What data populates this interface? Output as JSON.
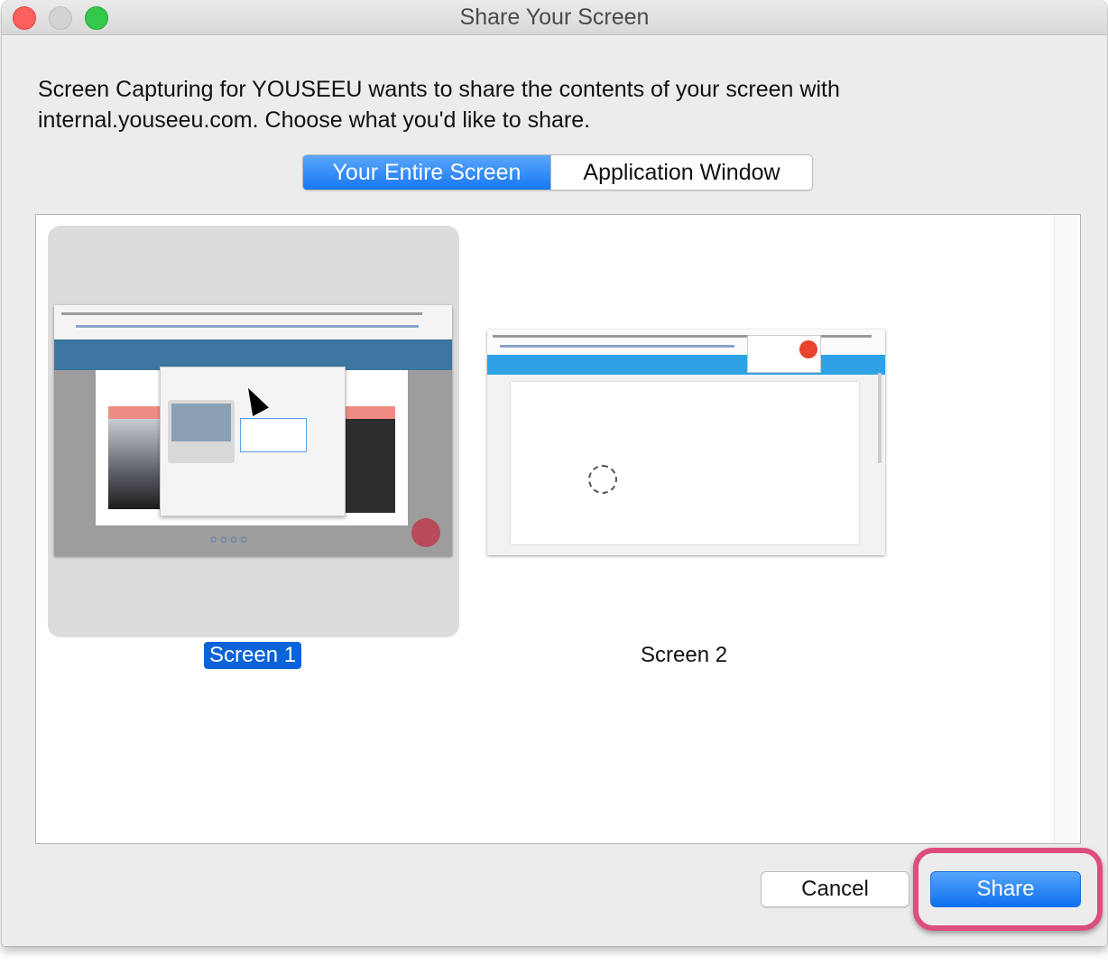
{
  "window": {
    "title": "Share Your Screen"
  },
  "message": "Screen Capturing for YOUSEEU wants to share the contents of your screen with internal.youseeu.com. Choose what you'd like to share.",
  "tabs": [
    {
      "label": "Your Entire Screen",
      "active": true
    },
    {
      "label": "Application Window",
      "active": false
    }
  ],
  "screens": [
    {
      "label": "Screen 1",
      "selected": true
    },
    {
      "label": "Screen 2",
      "selected": false
    }
  ],
  "buttons": {
    "cancel": "Cancel",
    "share": "Share"
  },
  "colors": {
    "accent": "#1777f2",
    "highlight": "#dd4d7f",
    "close": "#fc605c",
    "zoom": "#34c84a"
  }
}
